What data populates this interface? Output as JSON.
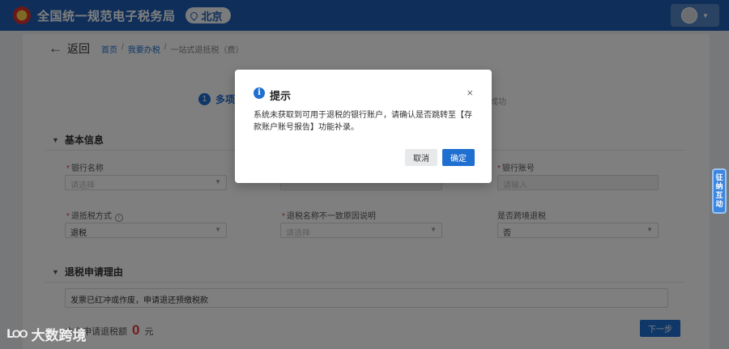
{
  "header": {
    "app_title": "全国统一规范电子税务局",
    "city": "北京"
  },
  "nav": {
    "back_label": "返回",
    "breadcrumbs": [
      "首页",
      "我要办税",
      "一站式退抵税（费）"
    ]
  },
  "steps": {
    "current_number": "1",
    "current_label": "多项",
    "right_label": "成功"
  },
  "basic_info": {
    "title": "基本信息",
    "bank_name": {
      "label": "银行名称",
      "placeholder": "请选择"
    },
    "bank_account": {
      "label": "银行账号",
      "placeholder": "请输入"
    },
    "refund_method": {
      "label": "退抵税方式",
      "value": "退税"
    },
    "name_mismatch_reason": {
      "label": "退税名称不一致原因说明",
      "placeholder": "请选择"
    },
    "cross_region": {
      "label": "是否跨境退税",
      "value": "否"
    }
  },
  "refund_reason": {
    "title": "退税申请理由",
    "text": "发票已红冲或作废，申请退还预缴税款"
  },
  "footer": {
    "amount_label": "本次申请退税额",
    "amount": "0",
    "unit": "元",
    "next_label": "下一步"
  },
  "side_widget": {
    "label": "征纳互动"
  },
  "dialog": {
    "title": "提示",
    "body": "系统未获取到可用于退税的银行账户，请确认是否跳转至【存款账户账号报告】功能补录。",
    "cancel_label": "取消",
    "ok_label": "确定"
  },
  "watermark": {
    "text": "大数跨境"
  },
  "colors": {
    "brand_blue": "#1f5fb4",
    "primary": "#1f6fd1",
    "amount_red": "#e23b3b"
  }
}
